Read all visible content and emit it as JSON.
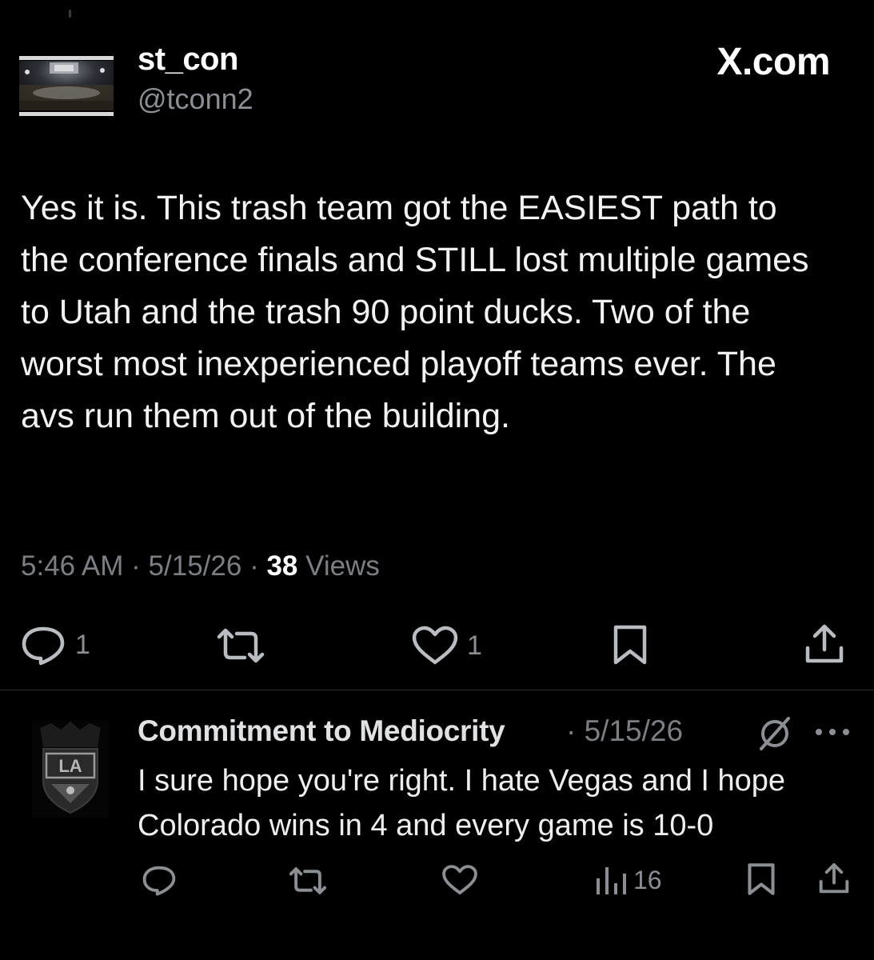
{
  "tweet": {
    "display_name": "st_con",
    "handle": "@tconn2",
    "brand": "X.com",
    "text": "Yes it is. This trash team got the EASIEST path to the conference finals and STILL lost multiple games to Utah and the trash 90 point ducks. Two of the worst most inexperienced playoff teams ever. The avs run them out of the building.",
    "time": "5:46 AM",
    "date": "5/15/26",
    "separator": "·",
    "views_count": "38",
    "views_label": "Views",
    "actions": {
      "reply_count": "1",
      "like_count": "1"
    }
  },
  "reply": {
    "display_name": "Commitment to Mediocrity",
    "separator": "·",
    "date": "5/15/26",
    "avatar_logo_text": "LA",
    "text": "I sure hope you're right.  I hate Vegas and I hope Colorado wins in 4 and every game is 10-0",
    "actions": {
      "views_count": "16"
    }
  },
  "icons": {
    "reply": "speech-bubble-icon",
    "repost": "repost-arrows-icon",
    "like": "heart-icon",
    "bookmark": "bookmark-icon",
    "share": "share-upload-icon",
    "views": "bar-chart-icon",
    "grok": "grok-slash-icon",
    "more": "ellipsis-icon"
  },
  "colors": {
    "background": "#000000",
    "primary_text": "#e7e9ea",
    "secondary_text": "#8b8f94",
    "divider": "#2f3336"
  }
}
